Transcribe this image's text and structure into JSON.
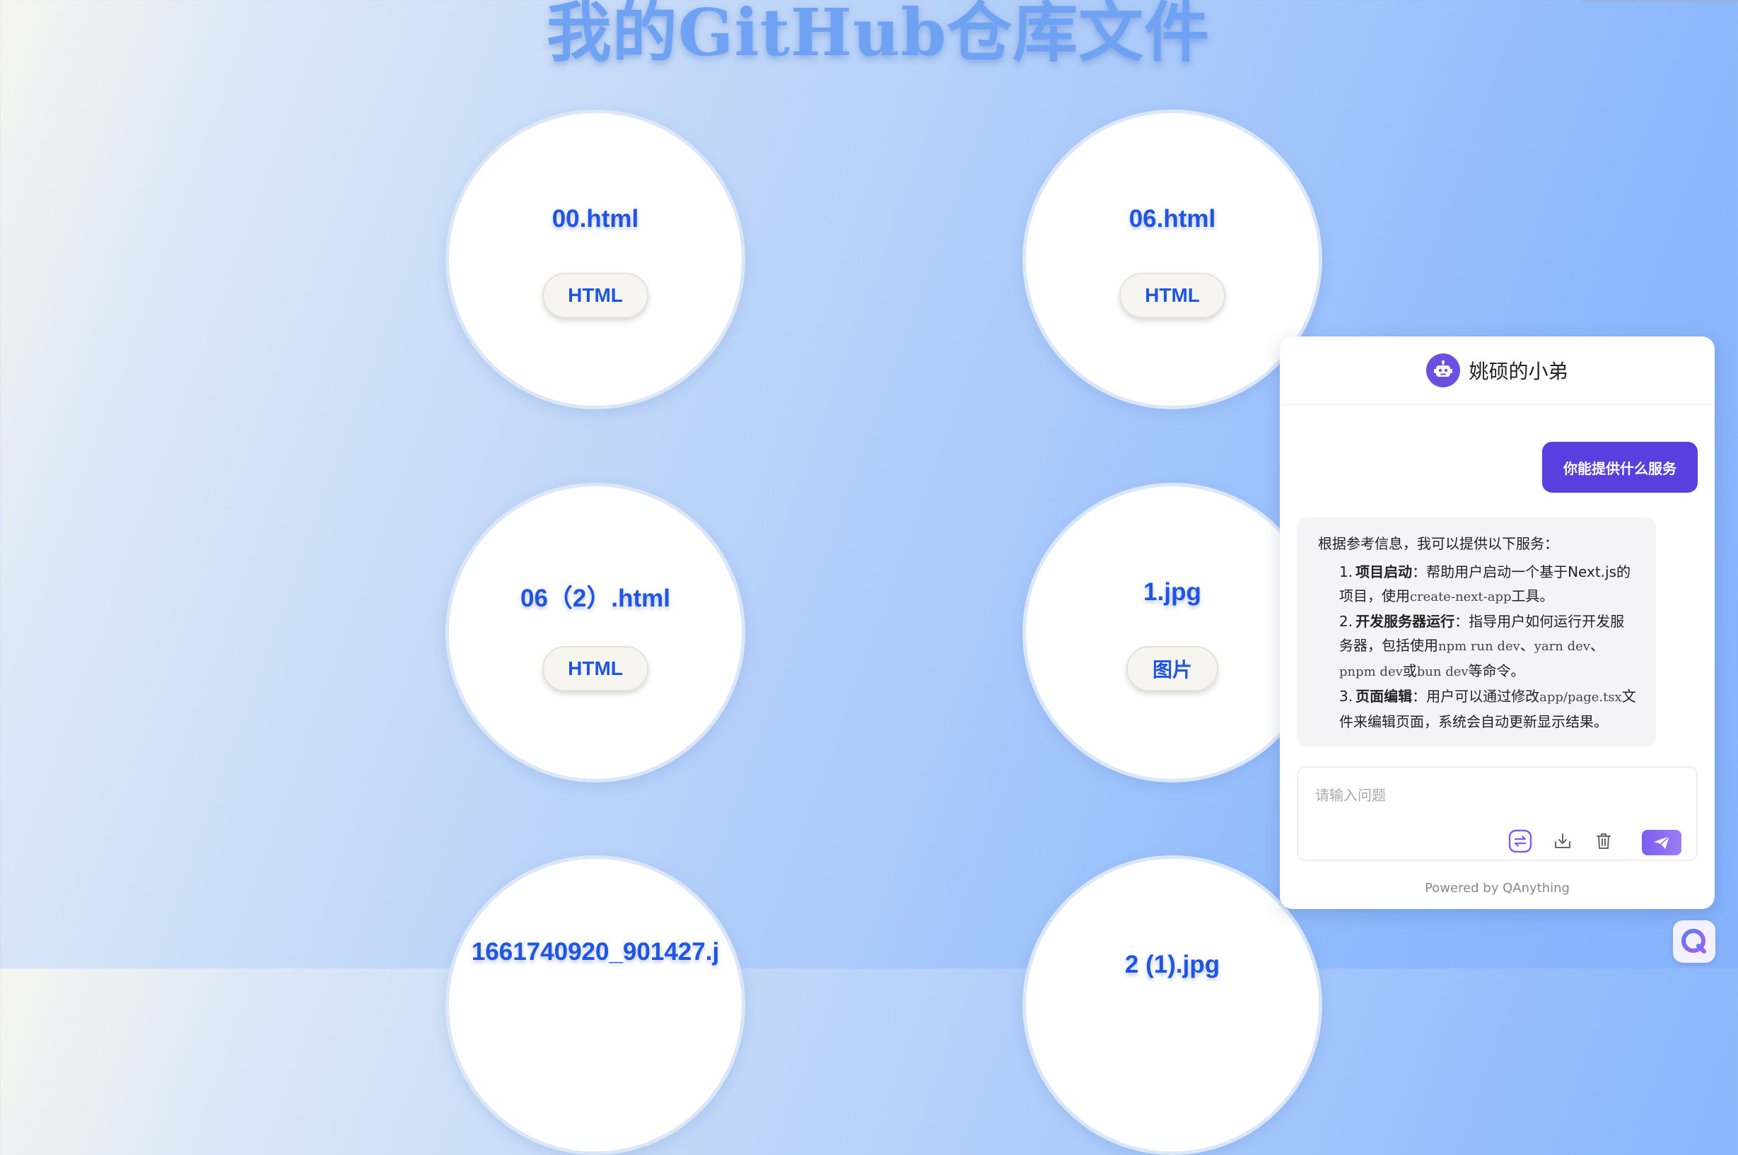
{
  "page": {
    "title": "我的GitHub仓库文件"
  },
  "files": [
    {
      "name": "00.html",
      "tag": "HTML"
    },
    {
      "name": "06.html",
      "tag": "HTML"
    },
    {
      "name": "06（2）.html",
      "tag": "HTML"
    },
    {
      "name": "1.jpg",
      "tag": "图片"
    },
    {
      "name": "1661740920_901427.j",
      "tag": ""
    },
    {
      "name": "2 (1).jpg",
      "tag": ""
    }
  ],
  "chat": {
    "title": "姚硕的小弟",
    "user_message": "你能提供什么服务",
    "bot_intro": "根据参考信息，我可以提供以下服务：",
    "bot_items": [
      {
        "num": "1.",
        "bold": "项目启动",
        "text_before": "：帮助用户启动一个基于Next.js的项目，使用",
        "code1": "create-next-app",
        "text_after": "工具。"
      },
      {
        "num": "2.",
        "bold": "开发服务器运行",
        "text_before": "：指导用户如何运行开发服务器，包括使用",
        "code1": "npm run dev",
        "sep1": "、",
        "code2": "yarn dev",
        "sep2": "、",
        "code3": "pnpm dev",
        "sep3": "或",
        "code4": "bun dev",
        "text_after": "等命令。"
      },
      {
        "num": "3.",
        "bold": "页面编辑",
        "text_before": "：用户可以通过修改",
        "code1": "app/page.tsx",
        "text_after": "文件来编辑页面，系统会自动更新显示结果。"
      }
    ],
    "input_placeholder": "请输入问题",
    "powered_by": "Powered by QAnything"
  },
  "colors": {
    "accent": "#5a3fe0",
    "file_name": "#1f55e6",
    "title": "#6fa2f2"
  },
  "icons": {
    "bot": "robot-icon",
    "tool1": "refresh-icon",
    "tool2": "download-icon",
    "tool3": "trash-icon",
    "send": "send-icon",
    "launcher": "qanything-logo-icon"
  }
}
